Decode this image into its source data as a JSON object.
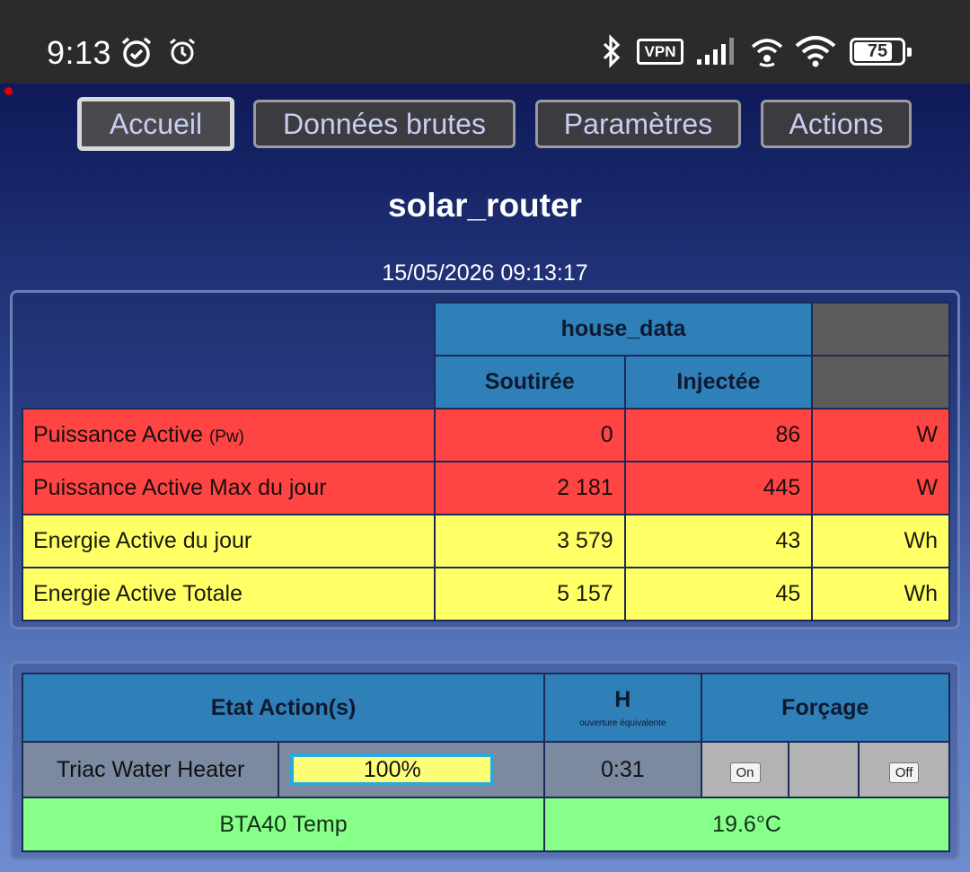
{
  "status_bar": {
    "time": "9:13",
    "vpn_label": "VPN",
    "battery": "75"
  },
  "nav": {
    "accueil": "Accueil",
    "donnees_brutes": "Données brutes",
    "parametres": "Paramètres",
    "actions": "Actions"
  },
  "page": {
    "title": "solar_router",
    "datetime": "15/05/2026 09:13:17"
  },
  "energy_table": {
    "group_header": "house_data",
    "col_soutiree": "Soutirée",
    "col_injectee": "Injectée",
    "rows": [
      {
        "label": "Puissance Active",
        "label_suffix": "(Pw)",
        "soutiree": "0",
        "injectee": "86",
        "unit": "W"
      },
      {
        "label": "Puissance Active Max du jour",
        "soutiree": "2 181",
        "injectee": "445",
        "unit": "W"
      },
      {
        "label": "Energie Active du jour",
        "soutiree": "3 579",
        "injectee": "43",
        "unit": "Wh"
      },
      {
        "label": "Energie Active Totale",
        "soutiree": "5 157",
        "injectee": "45",
        "unit": "Wh"
      }
    ]
  },
  "actions_table": {
    "header_etat": "Etat Action(s)",
    "header_h": "H",
    "header_h_sub": "ouverture équivalente",
    "header_forcage": "Forçage",
    "triac": {
      "name": "Triac Water Heater",
      "percent": "100%",
      "duration": "0:31",
      "on_label": "On",
      "off_label": "Off"
    },
    "sensor": {
      "name": "BTA40 Temp",
      "value": "19.6°C"
    }
  },
  "colors": {
    "header_blue": "#2f7fb8",
    "power_red": "#ff4444",
    "energy_yellow": "#ffff66",
    "sensor_green": "#88ff88"
  }
}
